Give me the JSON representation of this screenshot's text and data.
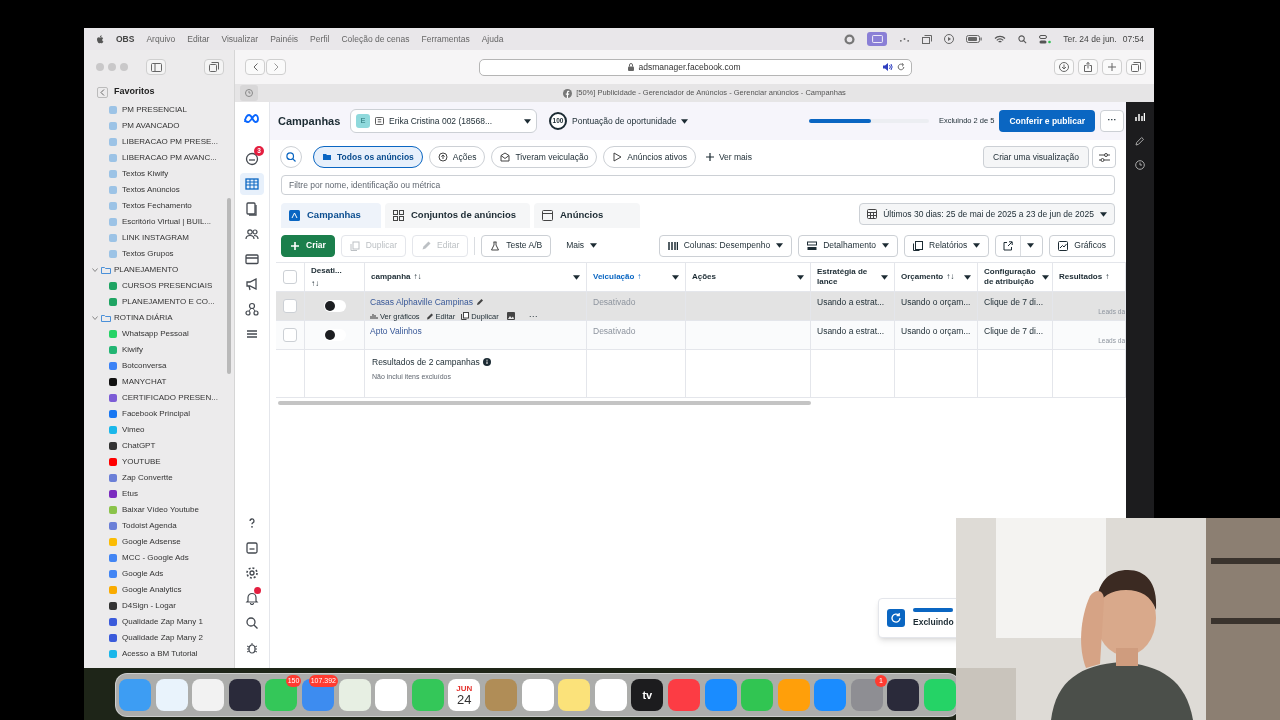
{
  "menu_bar": {
    "app": "OBS",
    "menus": [
      "Arquivo",
      "Editar",
      "Visualizar",
      "Painéis",
      "Perfil",
      "Coleção de cenas",
      "Ferramentas",
      "Ajuda"
    ],
    "date": "Ter. 24 de jun.",
    "time": "07:54"
  },
  "browser": {
    "address": "adsmanager.facebook.com",
    "audio_playing": true,
    "page_title": "[50%] Publicidade - Gerenciador de Anúncios - Gerenciar anúncios - Campanhas"
  },
  "sidebar": {
    "title": "Favoritos",
    "items": [
      {
        "kind": "link",
        "label": "PM PRESENCIAL",
        "color": "#9cc3e6"
      },
      {
        "kind": "link",
        "label": "PM AVANCADO",
        "color": "#9cc3e6"
      },
      {
        "kind": "link",
        "label": "LIBERACAO PM PRESE...",
        "color": "#9cc3e6"
      },
      {
        "kind": "link",
        "label": "LIBERACAO PM AVANC...",
        "color": "#9cc3e6"
      },
      {
        "kind": "link",
        "label": "Textos Kiwify",
        "color": "#9cc3e6"
      },
      {
        "kind": "link",
        "label": "Textos Anúncios",
        "color": "#9cc3e6"
      },
      {
        "kind": "link",
        "label": "Textos Fechamento",
        "color": "#9cc3e6"
      },
      {
        "kind": "link",
        "label": "Escritório Virtual | BUIL...",
        "color": "#9cc3e6"
      },
      {
        "kind": "link",
        "label": "LINK INSTAGRAM",
        "color": "#9cc3e6"
      },
      {
        "kind": "link",
        "label": "Textos Grupos",
        "color": "#9cc3e6"
      },
      {
        "kind": "folder",
        "label": "PLANEJAMENTO",
        "expanded": true,
        "children": [
          {
            "kind": "link",
            "label": "CURSOS PRESENCIAIS",
            "color": "#1fa463"
          },
          {
            "kind": "link",
            "label": "PLANEJAMENTO E CO...",
            "color": "#1fa463"
          }
        ]
      },
      {
        "kind": "folder",
        "label": "ROTINA DIÁRIA",
        "expanded": true,
        "children": [
          {
            "kind": "link",
            "label": "Whatsapp Pessoal",
            "color": "#25d366"
          },
          {
            "kind": "link",
            "label": "Kiwify",
            "color": "#22b573"
          },
          {
            "kind": "link",
            "label": "Botconversa",
            "color": "#3b82f6"
          },
          {
            "kind": "link",
            "label": "MANYCHAT",
            "color": "#111111"
          },
          {
            "kind": "link",
            "label": "CERTIFICADO PRESEN...",
            "color": "#7c5cd6"
          },
          {
            "kind": "link",
            "label": "Facebook Principal",
            "color": "#1877f2"
          },
          {
            "kind": "link",
            "label": "Vimeo",
            "color": "#1ab7ea"
          },
          {
            "kind": "link",
            "label": "ChatGPT",
            "color": "#333333"
          },
          {
            "kind": "link",
            "label": "YOUTUBE",
            "color": "#ff0000"
          },
          {
            "kind": "link",
            "label": "Zap Convertte",
            "color": "#6b7fd7"
          },
          {
            "kind": "link",
            "label": "Etus",
            "color": "#7b2cbf"
          },
          {
            "kind": "link",
            "label": "Baixar Vídeo Youtube",
            "color": "#8bc34a"
          },
          {
            "kind": "link",
            "label": "Todoist Agenda",
            "color": "#6b7fd7"
          },
          {
            "kind": "link",
            "label": "Google Adsense",
            "color": "#fbbc04"
          },
          {
            "kind": "link",
            "label": "MCC - Google Ads",
            "color": "#4285f4"
          },
          {
            "kind": "link",
            "label": "Google Ads",
            "color": "#4285f4"
          },
          {
            "kind": "link",
            "label": "Google Analytics",
            "color": "#f9ab00"
          },
          {
            "kind": "link",
            "label": "D4Sign - Logar",
            "color": "#333333"
          },
          {
            "kind": "link",
            "label": "Qualidade Zap Many 1",
            "color": "#3b5bdb"
          },
          {
            "kind": "link",
            "label": "Qualidade Zap Many 2",
            "color": "#3b5bdb"
          },
          {
            "kind": "link",
            "label": "Acesso a BM Tutorial",
            "color": "#1ab7ea"
          }
        ]
      }
    ]
  },
  "ads_manager": {
    "title": "Campanhas",
    "account": {
      "initial": "E",
      "name": "Erika Cristina 002 (18568..."
    },
    "opportunity": {
      "score": "100",
      "label": "Pontuação de oportunidade"
    },
    "progress": {
      "level": 0.52,
      "text": "Excluindo 2 de 5"
    },
    "publish_button": "Conferir e publicar",
    "more_button": "···",
    "notifications_badge": "3",
    "filters": [
      {
        "label": "Todos os anúncios",
        "selected": true
      },
      {
        "label": "Ações",
        "selected": false
      },
      {
        "label": "Tiveram veiculação",
        "selected": false
      },
      {
        "label": "Anúncios ativos",
        "selected": false
      }
    ],
    "see_more": "Ver mais",
    "create_view": "Criar uma visualização",
    "search_placeholder": "Filtre por nome, identificação ou métrica",
    "tabs": [
      {
        "label": "Campanhas",
        "selected": true
      },
      {
        "label": "Conjuntos de anúncios",
        "selected": false
      },
      {
        "label": "Anúncios",
        "selected": false
      }
    ],
    "date_range": "Últimos 30 dias: 25 de mai de 2025 a 23 de jun de 2025",
    "actions": [
      {
        "label": "Criar",
        "kind": "primary",
        "disabled": false
      },
      {
        "label": "Duplicar",
        "kind": "normal",
        "disabled": true
      },
      {
        "label": "Editar",
        "kind": "normal",
        "disabled": true
      },
      {
        "label": "Teste A/B",
        "kind": "normal",
        "disabled": false
      },
      {
        "label": "Mais",
        "kind": "menu",
        "disabled": false
      }
    ],
    "view_actions": [
      {
        "label": "Colunas: Desempenho",
        "kind": "menu"
      },
      {
        "label": "Detalhamento",
        "kind": "menu"
      },
      {
        "label": "Relatórios",
        "kind": "menu"
      },
      {
        "kind": "export"
      },
      {
        "label": "Gráficos",
        "kind": "normal"
      }
    ],
    "table": {
      "select_all": false,
      "columns": [
        {
          "label": "Desati...",
          "sort": "↑↓",
          "menu": false,
          "active": false
        },
        {
          "label": "campanha",
          "sort": "↑↓",
          "menu": true,
          "active": false
        },
        {
          "label": "Veiculação",
          "sort": "↑",
          "menu": true,
          "active": true
        },
        {
          "label": "Ações",
          "menu": true,
          "active": false
        },
        {
          "label": "Estratégia de lance",
          "menu": true,
          "active": false
        },
        {
          "label": "Orçamento",
          "sort": "↑↓",
          "menu": true,
          "active": false
        },
        {
          "label": "Configuração de atribuição",
          "menu": true,
          "active": false
        },
        {
          "label": "Resultados",
          "sort": "↑",
          "menu": false,
          "active": false
        }
      ],
      "rows": [
        {
          "checked": false,
          "on": false,
          "highlighted": true,
          "name": "Casas Alphaville Campinas",
          "row_actions": [
            "Ver gráficos",
            "Editar",
            "Duplicar"
          ],
          "more": "···",
          "delivery": "Desativado",
          "bid_strategy": "Usando a estrat...",
          "budget": "Usando o orçam...",
          "attribution": "Clique de 7 di...",
          "results_note": "Leads da"
        },
        {
          "checked": false,
          "on": false,
          "highlighted": false,
          "name": "Apto Valinhos",
          "delivery": "Desativado",
          "bid_strategy": "Usando a estrat...",
          "budget": "Usando o orçam...",
          "attribution": "Clique de 7 di...",
          "results_note": "Leads da"
        }
      ],
      "summary": "Resultados de 2 campanhas",
      "summary_note": "Não inclui itens excluídos"
    }
  },
  "toast": {
    "text": "Excluindo",
    "level": 1
  },
  "dock": [
    {
      "color": "#3d9df3"
    },
    {
      "color": "#e9f3fc"
    },
    {
      "color": "#f2f2f2"
    },
    {
      "color": "#2a2a3a"
    },
    {
      "color": "#34c759",
      "badge": "150"
    },
    {
      "color": "#3d8cf0",
      "badge": "107.392"
    },
    {
      "color": "#e7efe3"
    },
    {
      "color": "#ffffff"
    },
    {
      "color": "#34c759"
    },
    {
      "color": "#ffffff",
      "top": "JUN",
      "label": "24"
    },
    {
      "color": "#b08d57"
    },
    {
      "color": "#ffffff"
    },
    {
      "color": "#fbe27a"
    },
    {
      "color": "#ffffff"
    },
    {
      "color": "#1c1c1e",
      "label": "tv"
    },
    {
      "color": "#fc3c44"
    },
    {
      "color": "#1a8cff"
    },
    {
      "color": "#31c552"
    },
    {
      "color": "#ff9f0a"
    },
    {
      "color": "#1a8cff"
    },
    {
      "color": "#8e8e93",
      "badge": "1"
    },
    {
      "color": "#2a2a3a"
    },
    {
      "color": "#25d366"
    }
  ]
}
